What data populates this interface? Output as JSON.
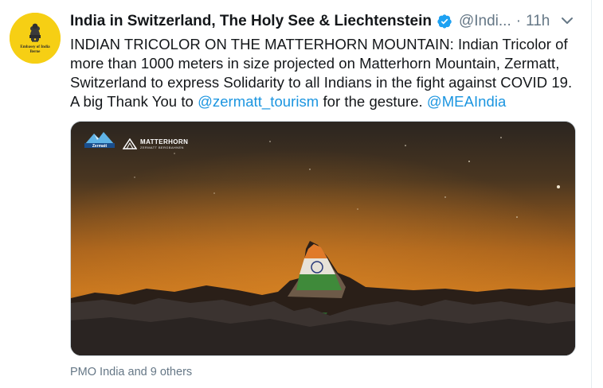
{
  "avatar": {
    "label": "Embassy of India Berne"
  },
  "header": {
    "display_name": "India in Switzerland, The Holy See & Liechtenstein",
    "handle": "@Indi...",
    "separator": "·",
    "time": "11h"
  },
  "tweet": {
    "text_plain": "INDIAN TRICOLOR ON THE MATTERHORN MOUNTAIN: Indian Tricolor of more than 1000 meters in size projected on Matterhorn Mountain, Zermatt, Switzerland to express Solidarity to all Indians in the fight against COVID 19. A big Thank You to ",
    "mention_1": "@zermatt_tourism",
    "text_middle": " for the gesture. ",
    "mention_2": "@MEAIndia"
  },
  "media": {
    "logo_zermatt": "Zermatt",
    "logo_matterhorn": "MATTERHORN",
    "logo_matterhorn_sub": "ZERMATT BERGBAHNEN"
  },
  "social_context": "PMO India and 9 others",
  "colors": {
    "link": "#1b95e0",
    "verified": "#1da1f2",
    "secondary_text": "#657786",
    "avatar_bg": "#f6cf14"
  },
  "icons": [
    "verified-badge-icon",
    "chevron-down-icon",
    "zermatt-logo-icon",
    "matterhorn-logo-icon"
  ]
}
